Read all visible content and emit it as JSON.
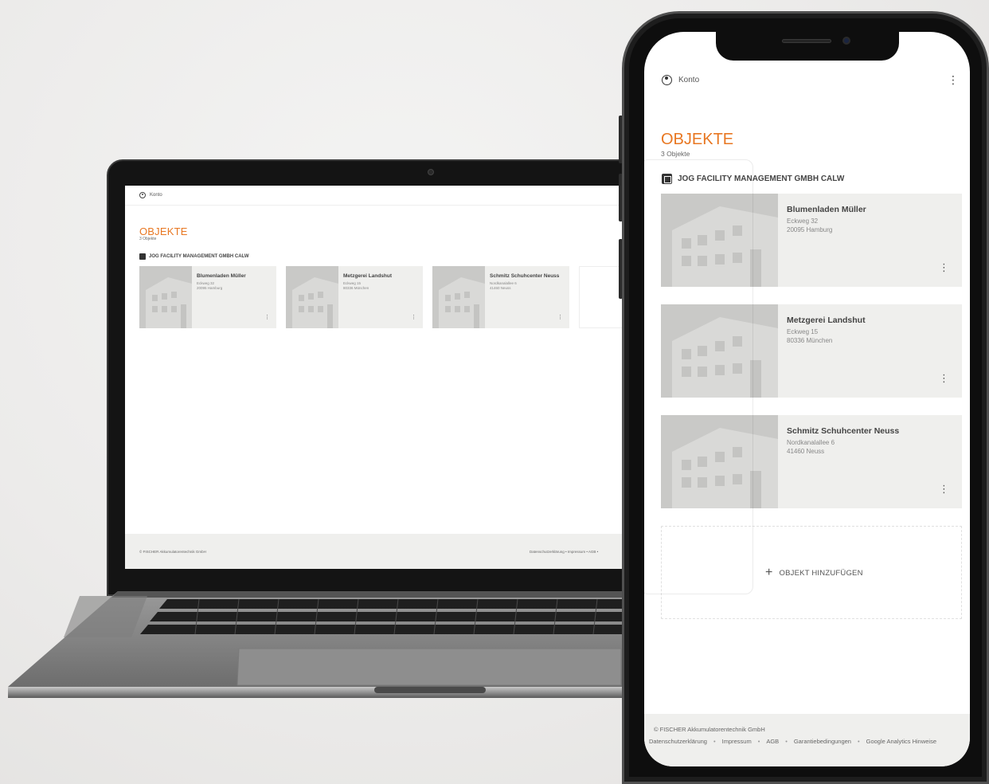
{
  "laptop": {
    "header": {
      "account_label": "Konto"
    },
    "page_title": "OBJEKTE",
    "object_count": "3 Objekte",
    "company_name": "JOG FACILITY MANAGEMENT GMBH CALW",
    "cards": [
      {
        "name": "Blumenladen Müller",
        "street": "Eckweg 32",
        "city": "20095 Hamburg"
      },
      {
        "name": "Metzgerei Landshut",
        "street": "Eckweg 15",
        "city": "80336 München"
      },
      {
        "name": "Schmitz Schuhcenter Neuss",
        "street": "Nordkanalallee 6",
        "city": "41460 Neuss"
      }
    ],
    "footer": {
      "copyright": "© FISCHER Akkumulatorentechnik GmbH",
      "links": "Datenschutzerklärung  •  Impressum  •  AGB  •"
    }
  },
  "phone": {
    "header": {
      "account_label": "Konto",
      "menu_glyph": "⋮"
    },
    "page_title": "OBJEKTE",
    "object_count": "3 Objekte",
    "company_name": "JOG FACILITY MANAGEMENT GMBH CALW",
    "cards": [
      {
        "name": "Blumenladen Müller",
        "street": "Eckweg 32",
        "city": "20095 Hamburg"
      },
      {
        "name": "Metzgerei Landshut",
        "street": "Eckweg 15",
        "city": "80336 München"
      },
      {
        "name": "Schmitz Schuhcenter Neuss",
        "street": "Nordkanalallee 6",
        "city": "41460 Neuss"
      }
    ],
    "add_object_label": "OBJEKT HINZUFÜGEN",
    "footer": {
      "copyright": "© FISCHER Akkumulatorentechnik GmbH",
      "links": [
        "Datenschutzerklärung",
        "Impressum",
        "AGB",
        "Garantiebedingungen",
        "Google Analytics Hinweise"
      ]
    }
  },
  "colors": {
    "accent": "#e87722",
    "card_bg": "#efefed",
    "image_placeholder": "#c9c9c7"
  }
}
